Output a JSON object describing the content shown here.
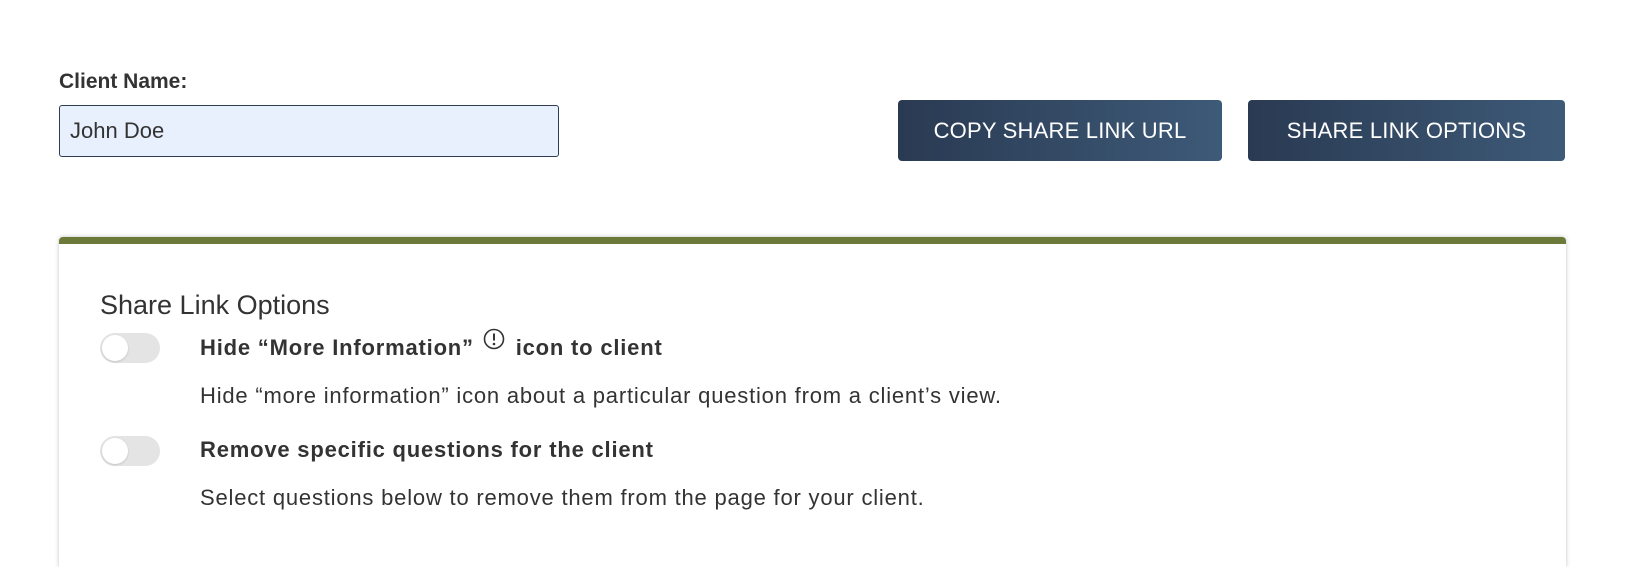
{
  "client": {
    "label": "Client Name:",
    "value": "John Doe"
  },
  "actions": {
    "copy_label": "COPY SHARE LINK URL",
    "options_label": "SHARE LINK OPTIONS"
  },
  "panel": {
    "title": "Share Link Options",
    "accent_color": "#6b7a38",
    "options": [
      {
        "title_before": "Hide “More Information”",
        "title_after": "icon to client",
        "icon": "info-circle-icon",
        "description": "Hide “more information” icon about a particular question from a client’s view.",
        "enabled": false
      },
      {
        "title": "Remove specific questions for the client",
        "description": "Select questions below to remove them from the page for your client.",
        "enabled": false
      }
    ]
  }
}
